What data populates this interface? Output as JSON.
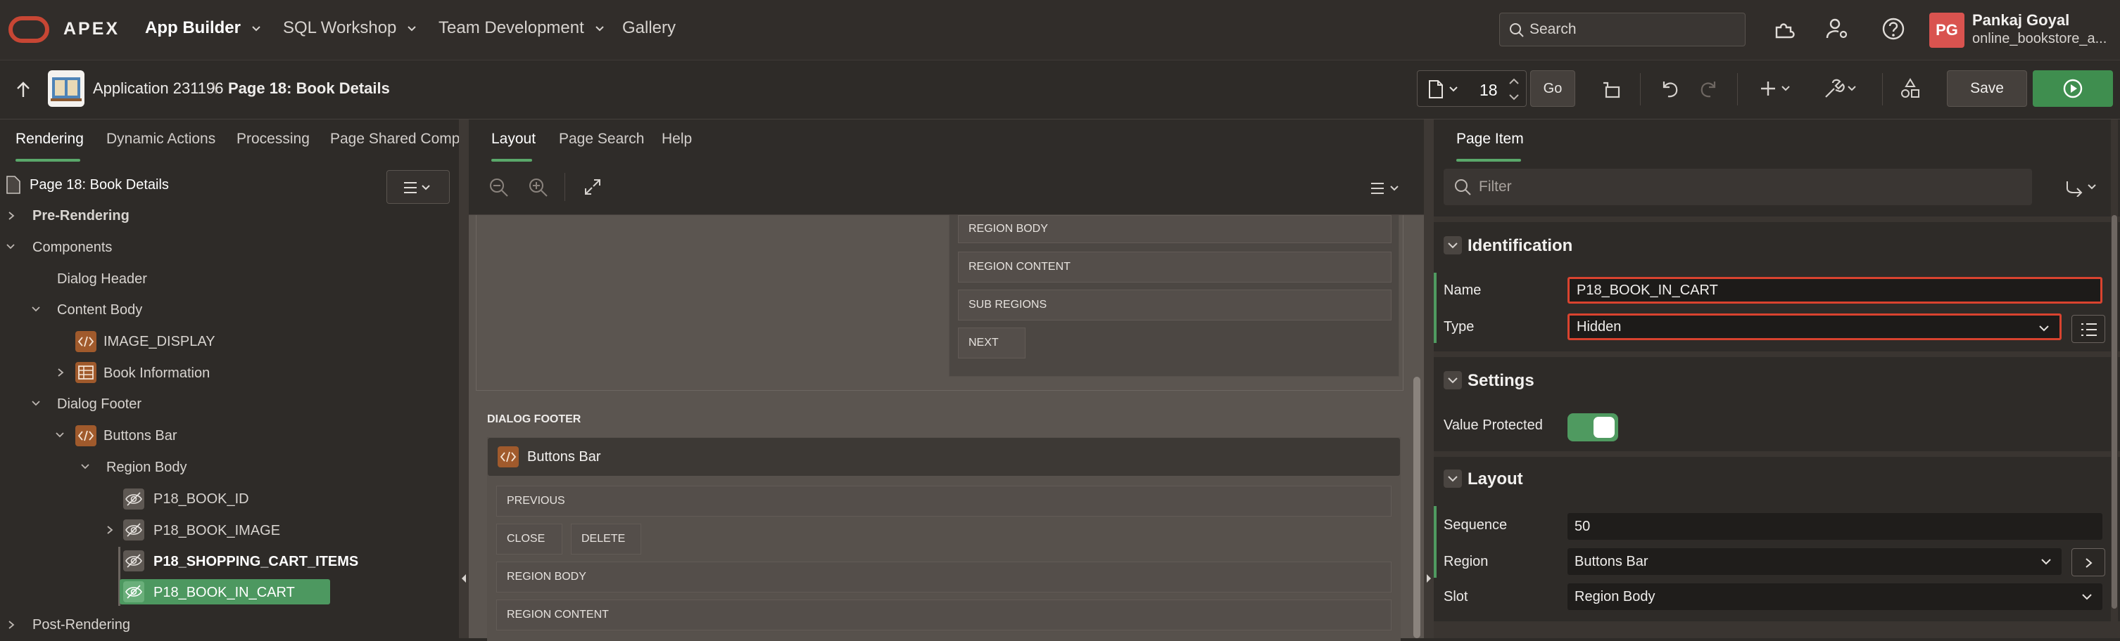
{
  "topbar": {
    "brand": "APEX",
    "nav": [
      "App Builder",
      "SQL Workshop",
      "Team Development",
      "Gallery"
    ],
    "search_placeholder": "Search",
    "user_initials": "PG",
    "user_name": "Pankaj Goyal",
    "workspace": "online_bookstore_a..."
  },
  "toolbar": {
    "application": "Application 231196",
    "page_title": "Page 18: Book Details",
    "page_number": "18",
    "go_label": "Go",
    "save_label": "Save"
  },
  "left": {
    "tabs": [
      "Rendering",
      "Dynamic Actions",
      "Processing",
      "Page Shared Compor"
    ],
    "tree": {
      "root": "Page 18: Book Details",
      "pre_rendering": "Pre-Rendering",
      "components": "Components",
      "dialog_header": "Dialog Header",
      "content_body": "Content Body",
      "image_display": "IMAGE_DISPLAY",
      "book_information": "Book Information",
      "dialog_footer": "Dialog Footer",
      "buttons_bar": "Buttons Bar",
      "region_body": "Region Body",
      "book_id": "P18_BOOK_ID",
      "book_image": "P18_BOOK_IMAGE",
      "shopping_cart_items": "P18_SHOPPING_CART_ITEMS",
      "book_in_cart": "P18_BOOK_IN_CART",
      "post_rendering": "Post-Rendering"
    }
  },
  "center": {
    "tabs": [
      "Layout",
      "Page Search",
      "Help"
    ],
    "upper_slots": [
      "REGION BODY",
      "REGION CONTENT",
      "SUB REGIONS",
      "NEXT"
    ],
    "dialog_footer_label": "DIALOG FOOTER",
    "buttons_bar_title": "Buttons Bar",
    "footer_slots": {
      "previous": "PREVIOUS",
      "close": "CLOSE",
      "delete": "DELETE",
      "region_body": "REGION BODY",
      "region_content": "REGION CONTENT"
    }
  },
  "right": {
    "tab": "Page Item",
    "filter_placeholder": "Filter",
    "identification": {
      "title": "Identification",
      "name_label": "Name",
      "name_value": "P18_BOOK_IN_CART",
      "type_label": "Type",
      "type_value": "Hidden"
    },
    "settings": {
      "title": "Settings",
      "value_protected_label": "Value Protected",
      "value_protected": true
    },
    "layout": {
      "title": "Layout",
      "sequence_label": "Sequence",
      "sequence_value": "50",
      "region_label": "Region",
      "region_value": "Buttons Bar",
      "slot_label": "Slot",
      "slot_value": "Region Body"
    }
  },
  "colors": {
    "accent_green": "#4f9a60",
    "oracle_red": "#c74634",
    "error_outline": "#d9432f"
  }
}
